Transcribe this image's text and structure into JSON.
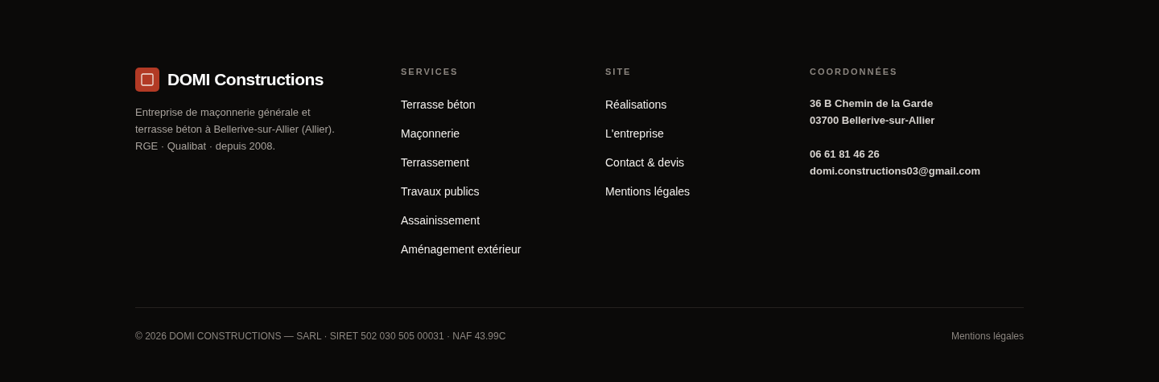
{
  "brand": {
    "name": "DOMI Constructions",
    "description": "Entreprise de maçonnerie générale et terrasse béton à Bellerive-sur-Allier (Allier). RGE · Qualibat · depuis 2008."
  },
  "columns": [
    {
      "heading": "SERVICES",
      "links": [
        "Terrasse béton",
        "Maçonnerie",
        "Terrassement",
        "Travaux publics",
        "Assainissement",
        "Aménagement extérieur"
      ]
    },
    {
      "heading": "SITE",
      "links": [
        "Réalisations",
        "L'entreprise",
        "Contact & devis",
        "Mentions légales"
      ]
    }
  ],
  "contact": {
    "heading": "COORDONNÉES",
    "address": [
      "36 B Chemin de la Garde",
      "03700 Bellerive-sur-Allier"
    ],
    "phone": "06 61 81 46 26",
    "email": "domi.constructions03@gmail.com"
  },
  "bottom": {
    "copyright": "© 2026 DOMI CONSTRUCTIONS — SARL · SIRET 502 030 505 00031 · NAF 43.99C",
    "link": "Mentions légales"
  }
}
